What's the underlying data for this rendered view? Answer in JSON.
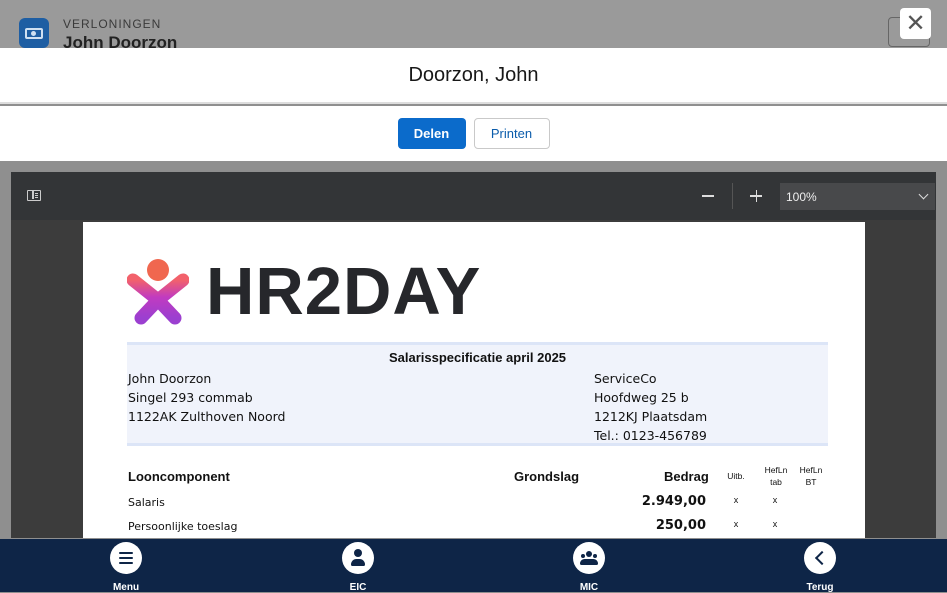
{
  "background": {
    "supertitle": "VERLONINGEN",
    "record_name": "John Doorzon"
  },
  "modal": {
    "close_glyph": "✕",
    "title": "Doorzon, John",
    "actions": {
      "share": "Delen",
      "print": "Printen"
    }
  },
  "viewer": {
    "zoom": "100%",
    "zoom_out_label": "Zoom out",
    "zoom_in_label": "Zoom in"
  },
  "document": {
    "brand": "HR2DAY",
    "spec_title": "Salarisspecificatie april 2025",
    "employee": [
      "John Doorzon",
      "Singel 293 commab",
      "1122AK Zulthoven Noord"
    ],
    "employer": [
      "ServiceCo",
      "Hoofdweg 25 b",
      "1212KJ Plaatsdam",
      "Tel.: 0123-456789"
    ],
    "columns": {
      "component": "Looncomponent",
      "basis": "Grondslag",
      "amount": "Bedrag",
      "uitb": "Uitb.",
      "heflntab": "HefLn tab",
      "heflnbt": "HefLn BT"
    },
    "rows": [
      {
        "label": "Salaris",
        "amount": "2.949,00",
        "uitb": "x",
        "heflntab": "x"
      },
      {
        "label": "Persoonlijke toeslag",
        "amount": "250,00",
        "uitb": "x",
        "heflntab": "x"
      }
    ]
  },
  "nav": {
    "menu": "Menu",
    "eic": "EIC",
    "mic": "MIC",
    "back": "Terug"
  },
  "colors": {
    "primary": "#0b6bcb",
    "nav_bg": "#0e2547",
    "brand_text": "#26272b",
    "logo_gradient": [
      "#f2616b",
      "#c13bc0",
      "#9b3fd0"
    ]
  }
}
